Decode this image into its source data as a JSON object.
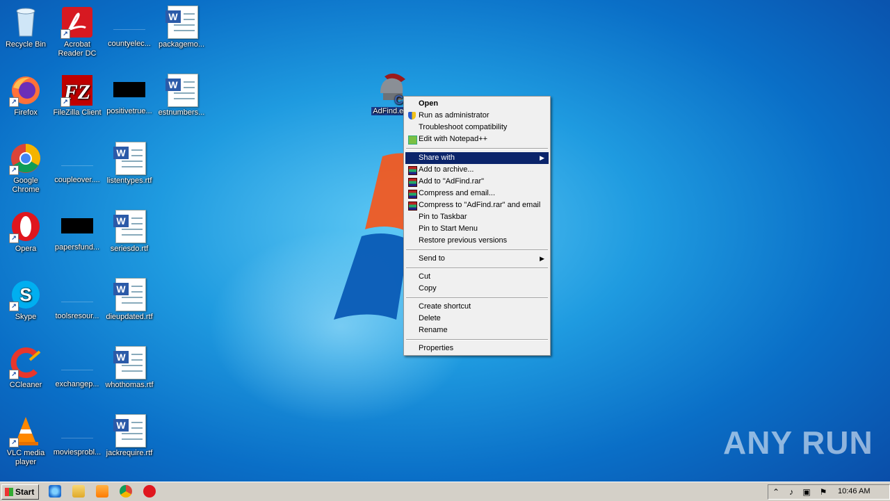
{
  "desktop": {
    "icons": [
      {
        "label": "Recycle Bin"
      },
      {
        "label": "Acrobat Reader DC"
      },
      {
        "label": "countyelec..."
      },
      {
        "label": "packagemo..."
      },
      {
        "label": "Firefox"
      },
      {
        "label": "FileZilla Client"
      },
      {
        "label": "positivetrue..."
      },
      {
        "label": "estnumbers..."
      },
      {
        "label": "Google Chrome"
      },
      {
        "label": "coupleover...."
      },
      {
        "label": "listentypes.rtf"
      },
      {
        "label": "Opera"
      },
      {
        "label": "papersfund..."
      },
      {
        "label": "seriesdo.rtf"
      },
      {
        "label": "Skype"
      },
      {
        "label": "toolsresour..."
      },
      {
        "label": "dieupdated.rtf"
      },
      {
        "label": "CCleaner"
      },
      {
        "label": "exchangep..."
      },
      {
        "label": "whothomas.rtf"
      },
      {
        "label": "VLC media player"
      },
      {
        "label": "moviesprobl..."
      },
      {
        "label": "jackrequire.rtf"
      }
    ],
    "selected_file": {
      "label": "AdFind.ex"
    }
  },
  "context_menu": {
    "items": [
      {
        "label": "Open",
        "bold": true
      },
      {
        "label": "Run as administrator",
        "icon": "uac-shield-icon"
      },
      {
        "label": "Troubleshoot compatibility"
      },
      {
        "label": "Edit with Notepad++",
        "icon": "notepadpp-icon"
      },
      {
        "label": "Share with",
        "submenu": true,
        "highlighted": true
      },
      {
        "label": "Add to archive...",
        "icon": "winrar-icon"
      },
      {
        "label": "Add to \"AdFind.rar\"",
        "icon": "winrar-icon"
      },
      {
        "label": "Compress and email...",
        "icon": "winrar-icon"
      },
      {
        "label": "Compress to \"AdFind.rar\" and email",
        "icon": "winrar-icon"
      },
      {
        "label": "Pin to Taskbar"
      },
      {
        "label": "Pin to Start Menu"
      },
      {
        "label": "Restore previous versions"
      },
      {
        "label": "Send to",
        "submenu": true
      },
      {
        "label": "Cut"
      },
      {
        "label": "Copy"
      },
      {
        "label": "Create shortcut"
      },
      {
        "label": "Delete"
      },
      {
        "label": "Rename"
      },
      {
        "label": "Properties"
      }
    ]
  },
  "taskbar": {
    "start_label": "Start",
    "quick_launch": [
      "internet-explorer-icon",
      "explorer-folder-icon",
      "media-player-icon",
      "chrome-icon",
      "opera-icon"
    ],
    "clock": "10:46 AM"
  },
  "watermark": "ANY RUN",
  "colors": {
    "highlight": "#0b246a",
    "desktop": "#1f9be0",
    "taskbar": "#d4d0c8"
  }
}
